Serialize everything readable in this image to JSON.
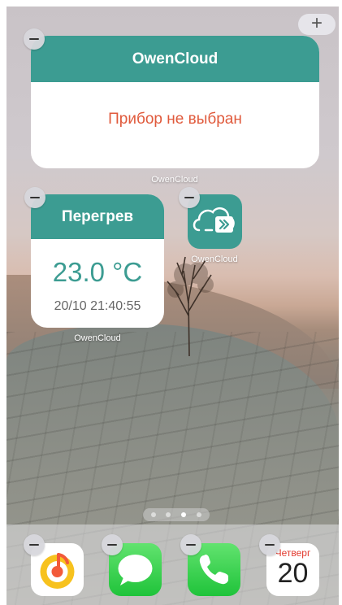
{
  "home": {
    "add_button": "+",
    "widget_large": {
      "title": "OwenCloud",
      "message": "Прибор не выбран",
      "caption": "OwenCloud"
    },
    "widget_small": {
      "title": "Перегрев",
      "temperature": "23.0 °C",
      "timestamp": "20/10 21:40:55",
      "caption": "OwenCloud"
    },
    "app": {
      "label": "OwenCloud",
      "icon": "owencloud-icon"
    },
    "page_indicator": {
      "pages": 4,
      "current": 3
    }
  },
  "dock": {
    "apps": [
      {
        "name": "music-app",
        "icon": "music-icon"
      },
      {
        "name": "messages-app",
        "icon": "message-bubble-icon"
      },
      {
        "name": "phone-app",
        "icon": "phone-icon"
      },
      {
        "name": "calendar-app",
        "weekday": "Четверг",
        "date": "20"
      }
    ]
  },
  "colors": {
    "accent": "#3c9c92",
    "error": "#e05a3c",
    "green": "#34c759"
  }
}
